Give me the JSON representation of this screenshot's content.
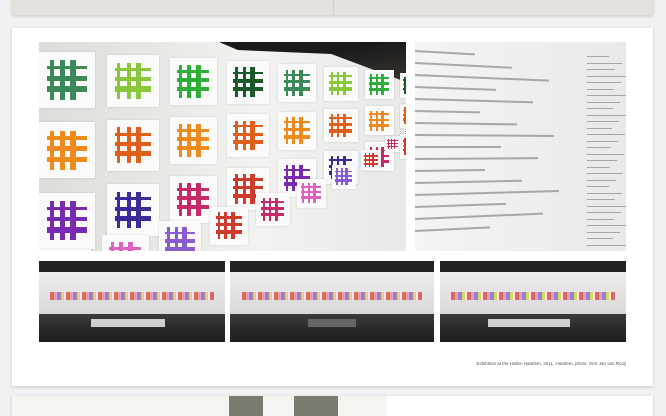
{
  "figure": {
    "caption": "Exhibition at the Hallen Haarlem, 2011, Haarlem, photo: Gert Jan van Rooij"
  },
  "colors": {
    "background": "#f0f1f3",
    "grid_colors": [
      "#3a8a5a",
      "#8ac83a",
      "#2db03a",
      "#1a5a2a",
      "#f08a1a",
      "#e0601a",
      "#7a2ab0",
      "#3a2a9a",
      "#c82a6a",
      "#d03a2a",
      "#e060c0",
      "#8a5ad0"
    ]
  }
}
